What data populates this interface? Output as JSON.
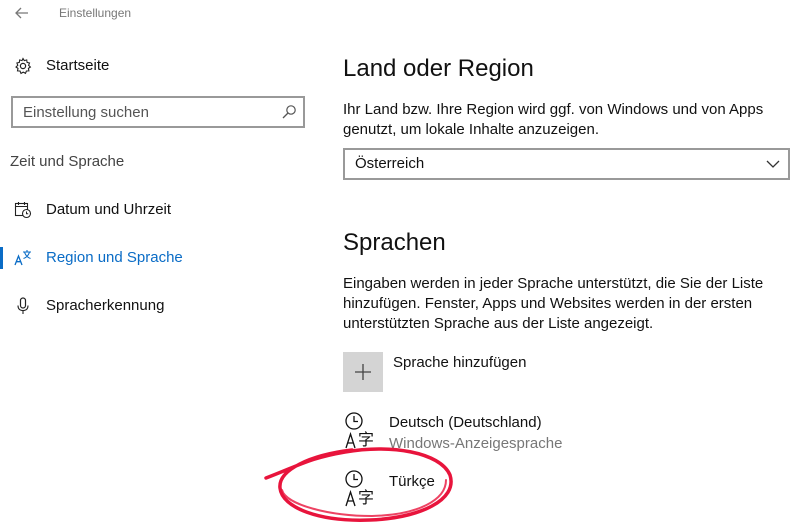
{
  "window": {
    "title": "Einstellungen",
    "back_icon": "back-arrow-icon"
  },
  "sidebar": {
    "home": {
      "label": "Startseite",
      "icon": "gear-icon"
    },
    "search": {
      "placeholder": "Einstellung suchen",
      "icon": "search-icon"
    },
    "section_title": "Zeit und Sprache",
    "items": [
      {
        "label": "Datum und Uhrzeit",
        "icon": "calendar-clock-icon",
        "active": false
      },
      {
        "label": "Region und Sprache",
        "icon": "language-icon",
        "active": true
      },
      {
        "label": "Spracherkennung",
        "icon": "microphone-icon",
        "active": false
      }
    ],
    "accent_color": "#0a6cc6"
  },
  "main": {
    "region": {
      "heading": "Land oder Region",
      "description": "Ihr Land bzw. Ihre Region wird ggf. von Windows und von Apps genutzt, um lokale Inhalte anzuzeigen.",
      "selected": "Österreich"
    },
    "languages": {
      "heading": "Sprachen",
      "description": "Eingaben werden in jeder Sprache unterstützt, die Sie der Liste hinzufügen. Fenster, Apps und Websites werden in der ersten unterstützten Sprache aus der Liste angezeigt.",
      "add_label": "Sprache hinzufügen",
      "items": [
        {
          "name": "Deutsch (Deutschland)",
          "subtitle": "Windows-Anzeigesprache",
          "icon": "language-pack-icon"
        },
        {
          "name": "Türkçe",
          "subtitle": "",
          "icon": "language-pack-icon"
        }
      ]
    }
  },
  "annotation": {
    "color": "#e8143c",
    "shape": "hand-drawn ellipse around Türkçe"
  }
}
